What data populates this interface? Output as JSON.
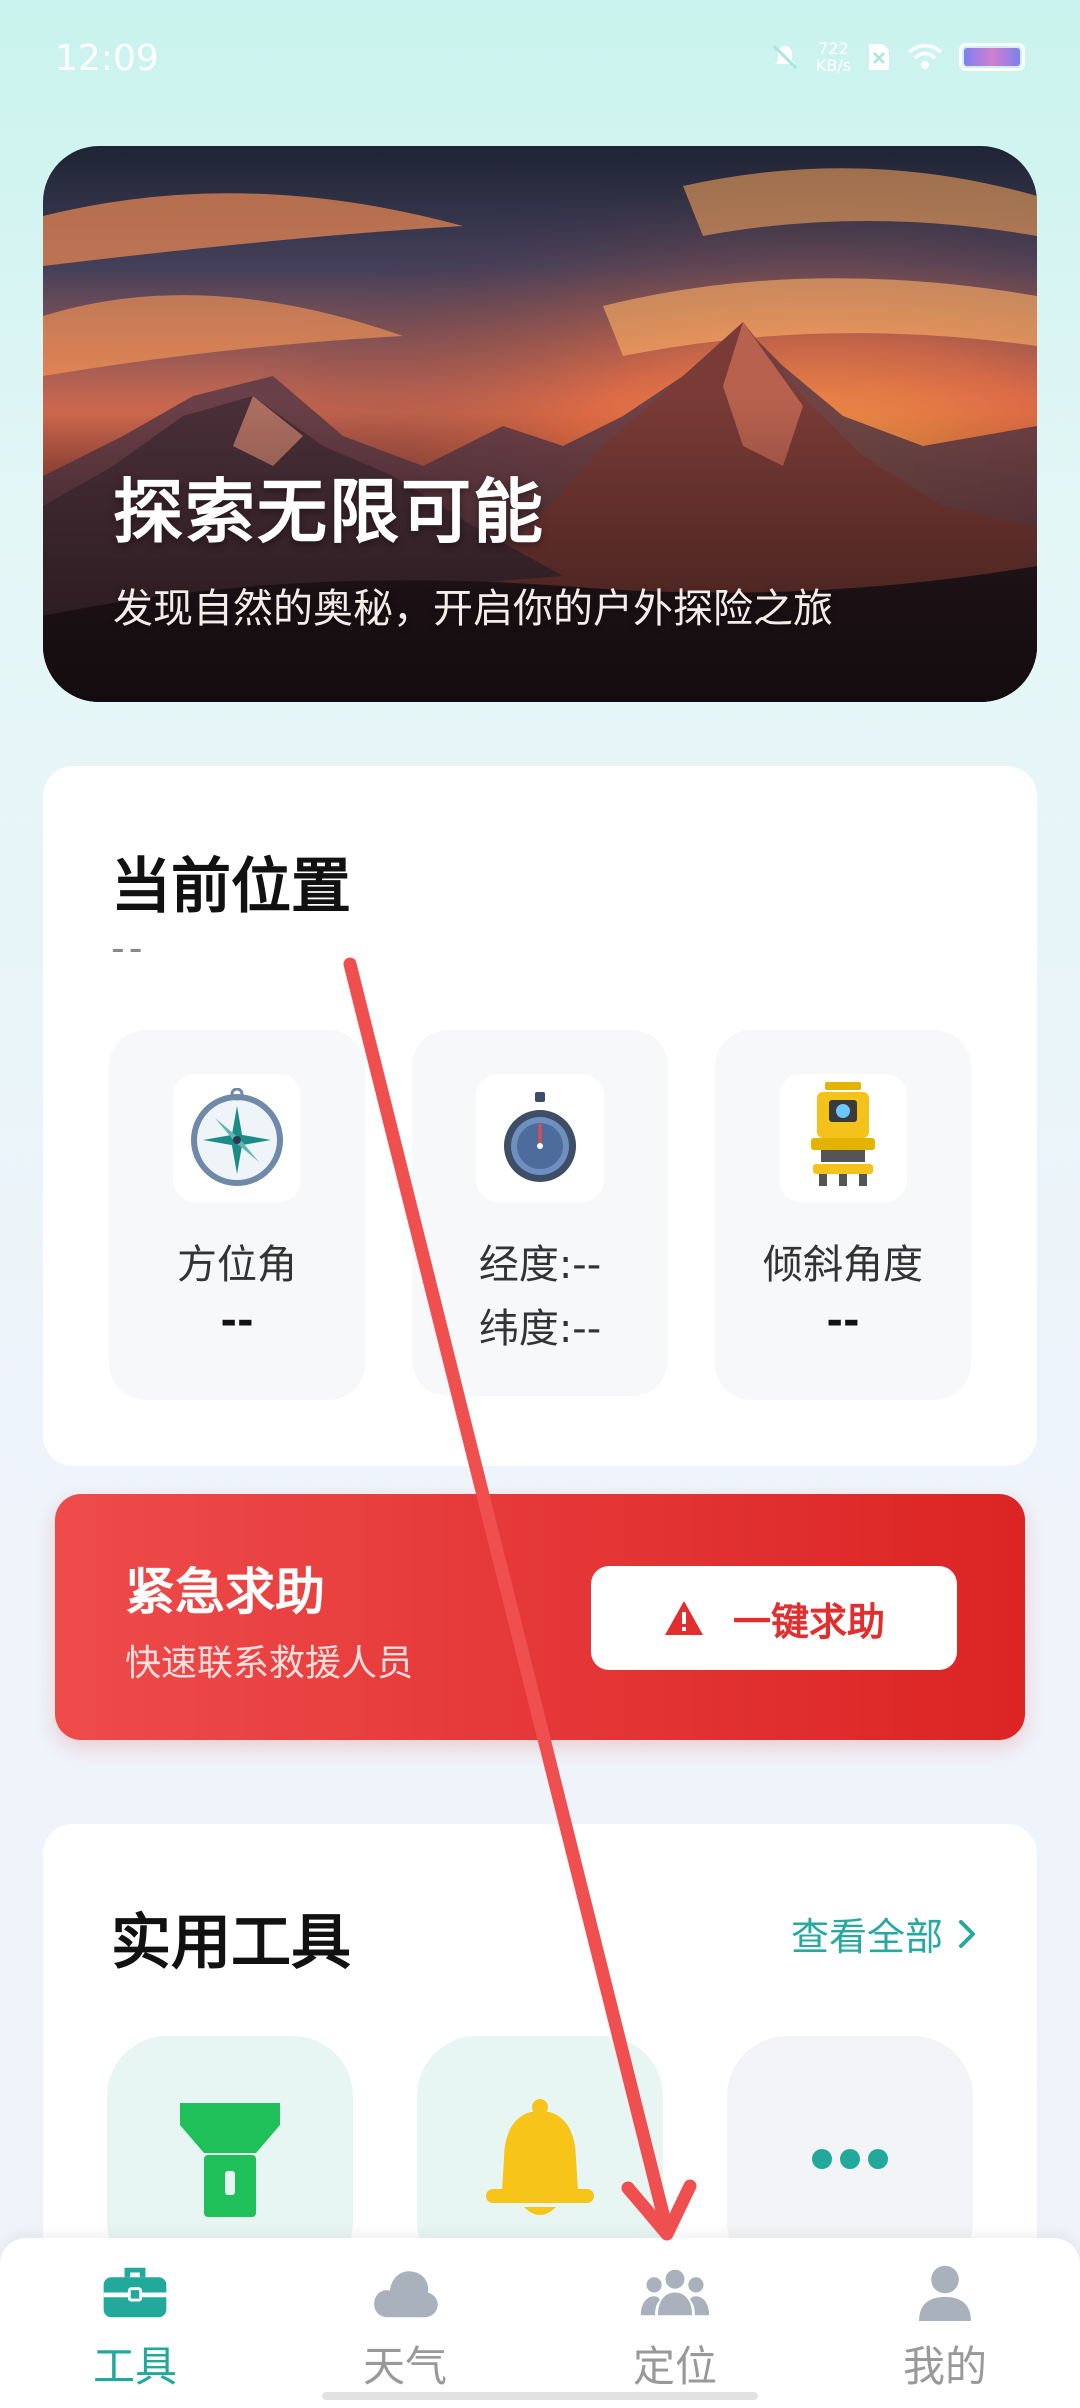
{
  "status_bar": {
    "time": "12:09",
    "speed_value": "722",
    "speed_unit": "KB/s"
  },
  "hero": {
    "title": "探索无限可能",
    "subtitle": "发现自然的奥秘，开启你的户外探险之旅"
  },
  "location": {
    "title": "当前位置",
    "value": "--",
    "tiles": [
      {
        "icon": "compass-icon",
        "label": "方位角",
        "value": "--"
      },
      {
        "icon": "stopwatch-icon",
        "label_longitude": "经度:--",
        "label_latitude": "纬度:--"
      },
      {
        "icon": "theodolite-icon",
        "label": "倾斜角度",
        "value": "--"
      }
    ]
  },
  "emergency": {
    "title": "紧急求助",
    "subtitle": "快速联系救援人员",
    "button_label": "一键求助",
    "button_icon": "warning-icon"
  },
  "tools": {
    "title": "实用工具",
    "view_all": "查看全部",
    "items": [
      {
        "icon": "flashlight-icon"
      },
      {
        "icon": "bell-icon"
      },
      {
        "icon": "more-icon"
      }
    ]
  },
  "nav": {
    "items": [
      {
        "label": "工具",
        "icon": "toolbox-icon",
        "active": true
      },
      {
        "label": "天气",
        "icon": "cloud-icon",
        "active": false
      },
      {
        "label": "定位",
        "icon": "people-icon",
        "active": false
      },
      {
        "label": "我的",
        "icon": "person-icon",
        "active": false
      }
    ]
  },
  "colors": {
    "accent": "#22a99b",
    "danger": "#e12f2f",
    "annotation_arrow": "#ef4f4f"
  }
}
